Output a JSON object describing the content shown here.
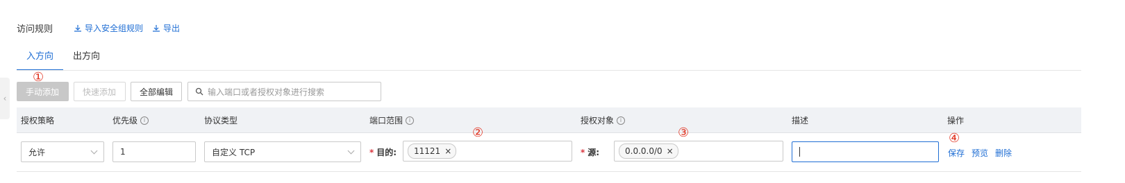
{
  "header": {
    "title": "访问规则",
    "import_label": "导入安全组规则",
    "export_label": "导出"
  },
  "tabs": [
    {
      "label": "入方向",
      "active": true
    },
    {
      "label": "出方向",
      "active": false
    }
  ],
  "toolbar": {
    "manual_add": "手动添加",
    "quick_add": "快速添加",
    "edit_all": "全部编辑",
    "search_placeholder": "输入端口或者授权对象进行搜索"
  },
  "table": {
    "columns": [
      "授权策略",
      "优先级",
      "协议类型",
      "端口范围",
      "授权对象",
      "描述",
      "操作"
    ],
    "row": {
      "policy": "允许",
      "priority": "1",
      "protocol": "自定义 TCP",
      "port_label": "目的:",
      "port_tag": "11121",
      "source_label": "源:",
      "source_tag": "0.0.0.0/0",
      "description": "",
      "actions": [
        "保存",
        "预览",
        "删除"
      ]
    }
  },
  "annotations": [
    "①",
    "②",
    "③",
    "④"
  ],
  "colors": {
    "accent": "#1f6ed4",
    "marker": "#e0311f"
  }
}
